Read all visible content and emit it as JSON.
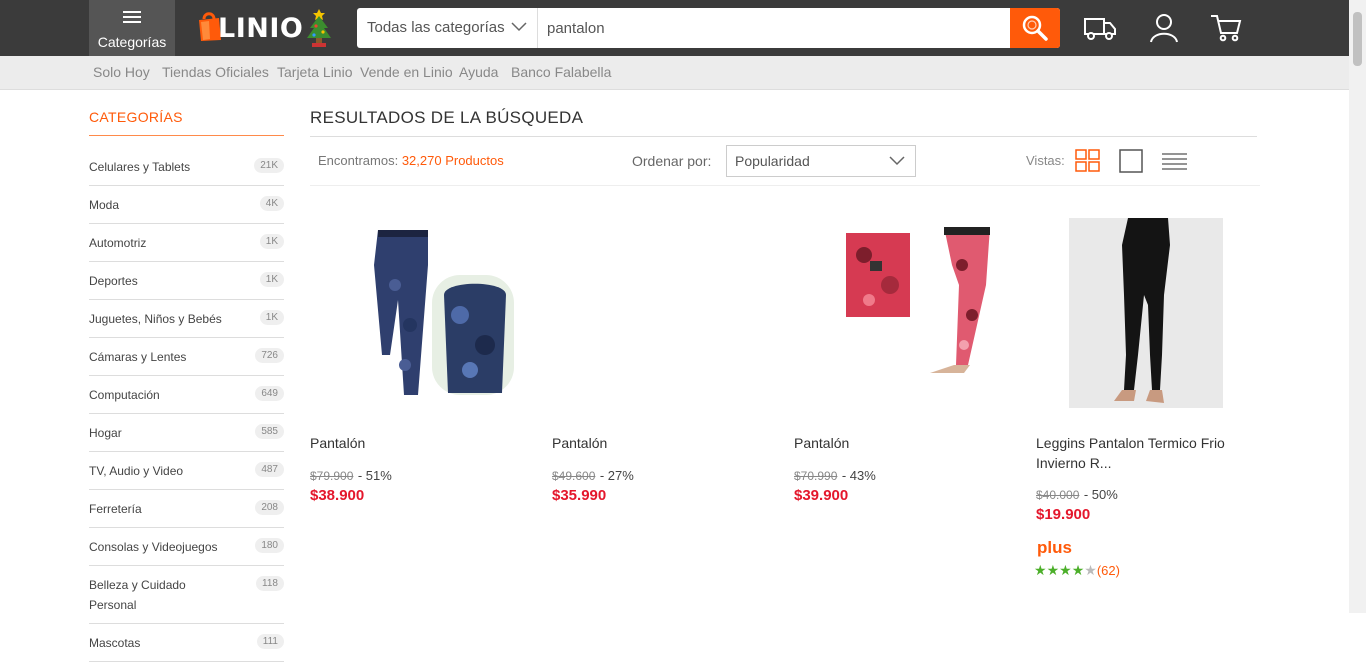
{
  "header": {
    "menu_label": "Categorías",
    "logo_text": "LINIO",
    "search_category": "Todas las categorías",
    "search_value": "pantalon",
    "icons": [
      "hamburger-icon",
      "shipping-truck-icon",
      "user-icon",
      "cart-icon",
      "search-icon"
    ]
  },
  "subnav": [
    "Solo Hoy",
    "Tiendas Oficiales",
    "Tarjeta Linio",
    "Vende en Linio",
    "Ayuda",
    "Banco Falabella"
  ],
  "sidebar": {
    "title": "CATEGORÍAS",
    "items": [
      {
        "label": "Celulares y Tablets",
        "count": "21K"
      },
      {
        "label": "Moda",
        "count": "4K"
      },
      {
        "label": "Automotriz",
        "count": "1K"
      },
      {
        "label": "Deportes",
        "count": "1K"
      },
      {
        "label": "Juguetes, Niños y Bebés",
        "count": "1K"
      },
      {
        "label": "Cámaras y Lentes",
        "count": "726"
      },
      {
        "label": "Computación",
        "count": "649"
      },
      {
        "label": "Hogar",
        "count": "585"
      },
      {
        "label": "TV, Audio y Video",
        "count": "487"
      },
      {
        "label": "Ferretería",
        "count": "208"
      },
      {
        "label": "Consolas y Videojuegos",
        "count": "180"
      },
      {
        "label": "Belleza y Cuidado Personal",
        "count": "118"
      },
      {
        "label": "Mascotas",
        "count": "111"
      }
    ]
  },
  "results": {
    "title": "RESULTADOS DE LA BÚSQUEDA",
    "found_prefix": "Encontramos:",
    "found_count": "32,270 Productos",
    "order_label": "Ordenar por:",
    "order_value": "Popularidad",
    "views_label": "Vistas:"
  },
  "products": [
    {
      "title": "Pantalón",
      "old_price": "$79.900",
      "discount": "- 51%",
      "price": "$38.900"
    },
    {
      "title": "Pantalón",
      "old_price": "$49.600",
      "discount": "- 27%",
      "price": "$35.990"
    },
    {
      "title": "Pantalón",
      "old_price": "$70.990",
      "discount": "- 43%",
      "price": "$39.900"
    },
    {
      "title": "Leggins Pantalon Termico Frio Invierno R...",
      "old_price": "$40.000",
      "discount": "- 50%",
      "price": "$19.900",
      "badge": "plus",
      "rating": 4,
      "rating_max": 5,
      "reviews": "(62)"
    }
  ],
  "colors": {
    "accent": "#ff5a0a",
    "price": "#e4172c",
    "topbar": "#3b3b3b",
    "stars": "#4caf2a"
  }
}
